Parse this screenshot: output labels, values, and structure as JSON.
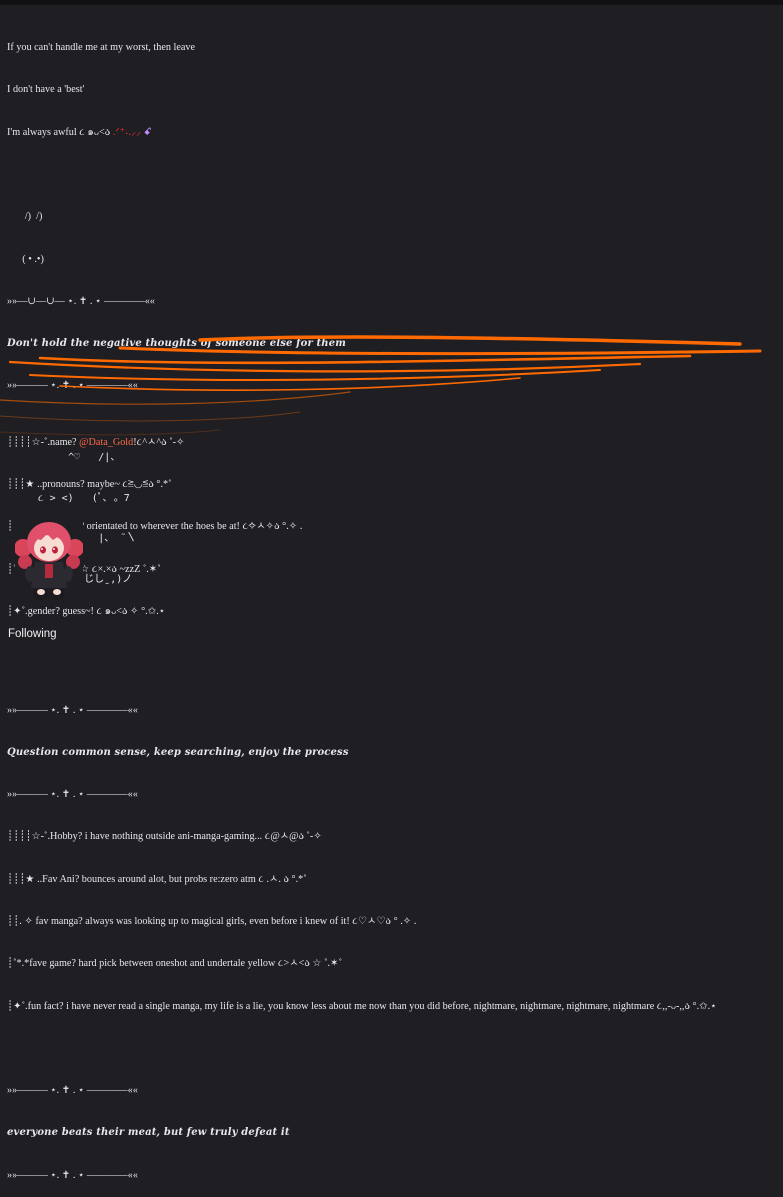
{
  "bio": {
    "intro": [
      "If you can't handle me at my worst, then leave",
      "I don't have a 'best'",
      "I'm always awful ૮ ๑ᴗ<ა "
    ],
    "intro_tail": ".ᐟ⁺˖.⸝⸝ ",
    "intro_tail_b": "ꗃ",
    "ears": "       /)  /)",
    "face": "      ( • .•)",
    "divider_top": "»»—∪—∪— ⋆. ✝ . ⋆ ————««",
    "heading1": "Don't hold the negative thoughts of someone else for them",
    "divider_1": "»»——— ⋆. ✝ . ⋆ ————««",
    "about": [
      {
        "pre": "┊┊┊┊☆-˚.name? ",
        "mention": "@Data_Gold",
        "post": "!૮^ㅅ^ა ˚-✧"
      },
      {
        "pre": "┊┊┊★ ..pronouns? maybe~ ૮≧◡≦ა °.*˚",
        "mention": "",
        "post": ""
      },
      {
        "pre": "┊┊. ✧ orientation? orientated to wherever the hoes be at! ૮✧ㅅ✧ა °.✧ .",
        "mention": "",
        "post": ""
      },
      {
        "pre": "┊˚*.*age? secret! ☆ ૮×.×ა ~zzZ ˚.✶˚",
        "mention": "",
        "post": ""
      },
      {
        "pre": "┊✦˚.gender? guess~! ૮ ๑ᴗ<ა ✧ °.✩.⋆",
        "mention": "",
        "post": ""
      }
    ],
    "divider_2": "»»——— ⋆. ✝ . ⋆ ————««",
    "heading2": "Question common sense, keep searching, enjoy the process",
    "divider_3": "»»——— ⋆. ✝ . ⋆ ————««",
    "facts": [
      "┊┊┊┊☆-˚.Hobby? i have nothing outside ani-manga-gaming... ૮@ㅅ@ა ˚-✧",
      "┊┊┊★ ..Fav Ani? bounces around alot, but probs re:zero atm ૮ .ㅅ. ა °.*˚",
      "┊┊. ✧ fav manga? always was looking up to magical girls, even before i knew of it! ૮♡ㅅ♡ა ° .✧ .",
      "┊˚*.*fave game? hard pick between oneshot and undertale yellow ૮>ㅅ<ა ☆ ˚.✶˚",
      "┊✦˚.fun fact? i have never read a single manga, my life is a lie, you know less about me now than you did before, nightmare, nightmare, nightmare, nightmare ૮,,-ᴗ-,,ა °.✩.⋆"
    ],
    "divider_4": "»»——— ⋆. ✝ . ⋆ ————««",
    "quote": "everyone beats their meat, but few truly defeat it",
    "divider_5": "»»——— ⋆. ✝ . ⋆ ————««"
  },
  "kaomoji_art": [
    "        ^♡   /|、",
    "   ૮ > <)   (ﾟ､ 。7",
    "    /⁻ |     |、 ˜〵",
    " ჳ(, ,ノ   じしˍ,)ノ"
  ],
  "section": {
    "following_label": "Following"
  },
  "colors": {
    "background": "#1f1f23",
    "mention": "#ff6b4a",
    "scribble": "#ff6a00"
  },
  "icons": {
    "avatar": "plush-avatar-icon"
  }
}
